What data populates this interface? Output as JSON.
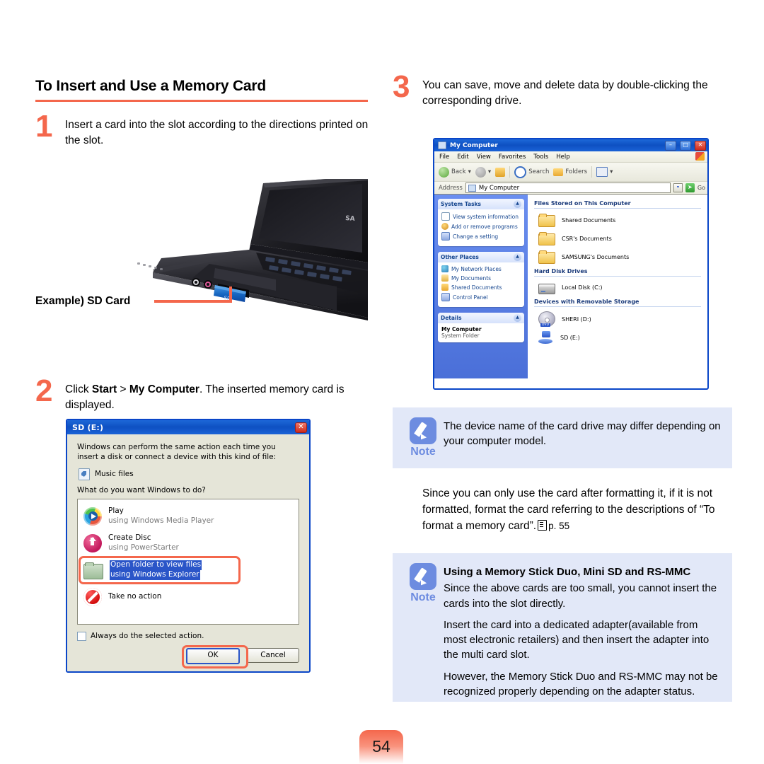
{
  "section": {
    "title": "To Insert and Use a Memory Card"
  },
  "steps": [
    {
      "number": "1",
      "text": "Insert a card into the slot according to the directions printed on the slot."
    },
    {
      "number": "2",
      "text_prefix": "Click ",
      "bold1": "Start",
      "mid": " > ",
      "bold2": "My Computer",
      "text_suffix": ". The inserted memory card is displayed."
    },
    {
      "number": "3",
      "text": "You can save, move and delete data by double-clicking the corresponding drive."
    }
  ],
  "photo": {
    "caption": "Example) SD Card"
  },
  "autoplay_dialog": {
    "title": "SD (E:)",
    "close_label": "✕",
    "intro": "Windows can perform the same action each time you insert a disk or connect a device with this kind of file:",
    "file_type": "Music files",
    "question": "What do you want Windows to do?",
    "actions": [
      {
        "title": "Play",
        "subtitle": "using Windows Media Player",
        "icon": "media-play-icon",
        "selected": false
      },
      {
        "title": "Create Disc",
        "subtitle": "using PowerStarter",
        "icon": "create-disc-icon",
        "selected": false
      },
      {
        "title": "Open folder to view files",
        "subtitle": "using Windows Explorer",
        "icon": "open-folder-icon",
        "selected": true
      },
      {
        "title": "Take no action",
        "subtitle": "",
        "icon": "no-action-icon",
        "selected": false
      }
    ],
    "checkbox_label": "Always do the selected action.",
    "ok_label": "OK",
    "cancel_label": "Cancel"
  },
  "explorer": {
    "title": "My Computer",
    "window_buttons": {
      "minimize": "–",
      "maximize": "□",
      "close": "✕"
    },
    "menus": [
      "File",
      "Edit",
      "View",
      "Favorites",
      "Tools",
      "Help"
    ],
    "toolbar": {
      "back": "Back",
      "forward": "",
      "up": "",
      "search": "Search",
      "folders": "Folders",
      "views": "▾"
    },
    "address": {
      "label": "Address",
      "value": "My Computer",
      "dropdown": "▾",
      "go_label": "Go",
      "go_icon": "➤"
    },
    "panes": [
      {
        "title": "System Tasks",
        "chevron": "▲",
        "items": [
          {
            "label": "View system information",
            "icon": "system-info-icon"
          },
          {
            "label": "Add or remove programs",
            "icon": "add-remove-programs-icon"
          },
          {
            "label": "Change a setting",
            "icon": "change-setting-icon"
          }
        ]
      },
      {
        "title": "Other Places",
        "chevron": "▲",
        "items": [
          {
            "label": "My Network Places",
            "icon": "network-places-icon"
          },
          {
            "label": "My Documents",
            "icon": "my-documents-icon"
          },
          {
            "label": "Shared Documents",
            "icon": "shared-documents-icon"
          },
          {
            "label": "Control Panel",
            "icon": "control-panel-icon"
          }
        ]
      },
      {
        "title": "Details",
        "chevron": "▲",
        "detail_name": "My Computer",
        "detail_sub": "System Folder"
      }
    ],
    "groups": [
      {
        "heading": "Files Stored on This Computer",
        "items": [
          {
            "label": "Shared Documents",
            "icon": "folder-icon"
          },
          {
            "label": "CSR's Documents",
            "icon": "folder-icon"
          },
          {
            "label": "SAMSUNG's Documents",
            "icon": "folder-icon"
          }
        ]
      },
      {
        "heading": "Hard Disk Drives",
        "items": [
          {
            "label": "Local Disk (C:)",
            "icon": "hard-disk-icon"
          }
        ]
      },
      {
        "heading": "Devices with Removable Storage",
        "items": [
          {
            "label": "SHERI (D:)",
            "icon": "dvd-drive-icon",
            "tag": "DVD"
          },
          {
            "label": "SD (E:)",
            "icon": "sd-card-drive-icon"
          }
        ]
      }
    ]
  },
  "note1": {
    "label": "Note",
    "text": "The device name of the card drive may differ depending on your computer model."
  },
  "format_paragraph": {
    "part1": "Since you can only use the card after formatting it, if it is not formatted, format the card referring to the descriptions of “To format a memory card”.",
    "page_ref": "p. 55"
  },
  "note2": {
    "label": "Note",
    "title": "Using a Memory Stick Duo, Mini SD and RS-MMC",
    "paragraphs": [
      "Since the above cards are too small, you cannot insert the cards into the slot directly.",
      "Insert the card into a dedicated adapter(available from most electronic retailers) and then insert the adapter into the multi card slot.",
      "However, the Memory Stick Duo and RS-MMC may not be recognized properly depending on the adapter status."
    ]
  },
  "footer": {
    "page_number": "54"
  },
  "colors": {
    "accent": "#f4674c",
    "note_bg": "#e2e8f8",
    "note_blue": "#6d8ce0",
    "xp_blue": "#0a46c8"
  }
}
